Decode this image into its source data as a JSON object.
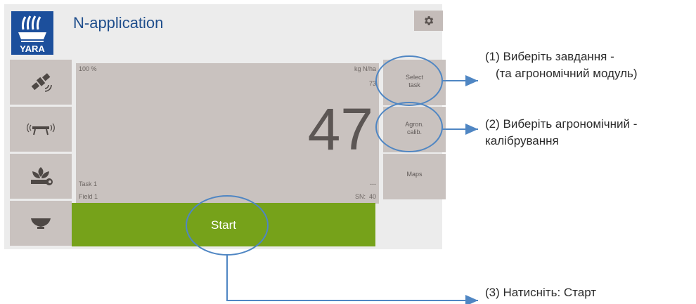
{
  "header": {
    "title": "N-application",
    "logo_text": "YARA"
  },
  "panel": {
    "percent": "100 %",
    "unit": "kg N/ha",
    "target_rate": "73",
    "current_rate": "47",
    "task": "Task 1",
    "task_value": "---",
    "field": "Field 1",
    "sn_label": "SN:",
    "sn_value": "40"
  },
  "right_buttons": {
    "select_task": [
      "Select",
      "task"
    ],
    "agron_calib": [
      "Agron.",
      "calib."
    ],
    "maps": "Maps"
  },
  "start_button": {
    "label": "Start"
  },
  "side_icons": [
    "satellite-icon",
    "boom-icon",
    "crop-wrench-icon",
    "hopper-icon"
  ],
  "annotations": {
    "a1_line1": "(1) Виберіть завдання -",
    "a1_line2": "(та агрономічний модуль)",
    "a2_line1": "(2) Виберіть агрономічний -",
    "a2_line2": "калібрування",
    "a3": "(3) Натисніть: Старт"
  },
  "colors": {
    "accent_blue": "#4f86c3",
    "start_green": "#76a21a",
    "panel_grey": "#c9c2bf",
    "brand_blue": "#1c4f9c"
  }
}
